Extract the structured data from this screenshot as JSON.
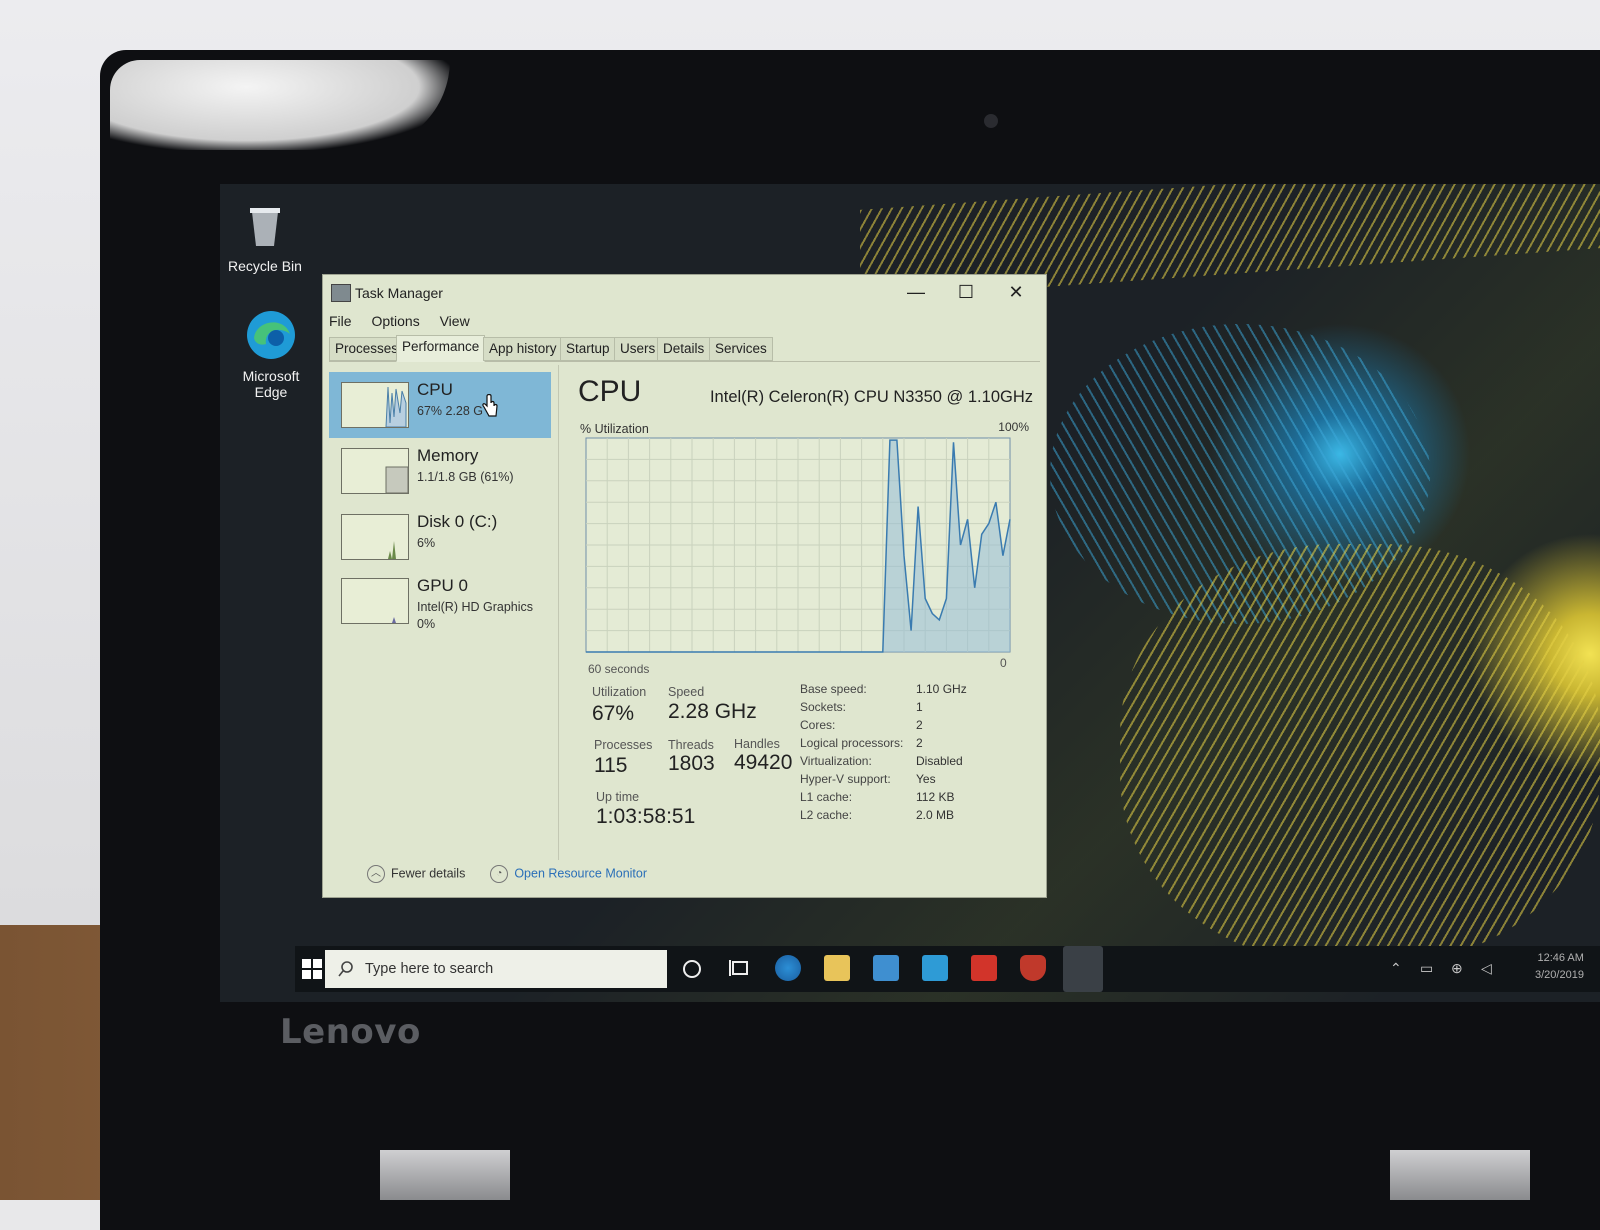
{
  "desktop": {
    "icons": [
      {
        "label": "Recycle Bin",
        "icon": "recycle-bin-icon"
      },
      {
        "label": "Microsoft Edge",
        "icon": "edge-icon"
      }
    ],
    "brand": "Lenovo"
  },
  "window": {
    "title": "Task Manager",
    "controls": {
      "minimize": "—",
      "maximize": "☐",
      "close": "✕"
    }
  },
  "menu": [
    "File",
    "Options",
    "View"
  ],
  "tabs": [
    "Processes",
    "Performance",
    "App history",
    "Startup",
    "Users",
    "Details",
    "Services"
  ],
  "active_tab": "Performance",
  "sidebar": [
    {
      "name": "CPU",
      "sub": "67% 2.28 G",
      "selected": true
    },
    {
      "name": "Memory",
      "sub": "1.1/1.8 GB (61%)",
      "selected": false
    },
    {
      "name": "Disk 0 (C:)",
      "sub": "6%",
      "selected": false
    },
    {
      "name": "GPU 0",
      "sub": "Intel(R) HD Graphics",
      "sub2": "0%",
      "selected": false
    }
  ],
  "detail": {
    "title": "CPU",
    "model": "Intel(R) Celeron(R) CPU N3350 @ 1.10GHz",
    "graph_label": "% Utilization",
    "graph_max": "100%",
    "graph_time": "60 seconds",
    "graph_min": "0",
    "stats": {
      "utilization_label": "Utilization",
      "utilization": "67%",
      "speed_label": "Speed",
      "speed": "2.28 GHz",
      "processes_label": "Processes",
      "processes": "115",
      "threads_label": "Threads",
      "threads": "1803",
      "handles_label": "Handles",
      "handles": "49420",
      "uptime_label": "Up time",
      "uptime": "1:03:58:51"
    },
    "specs": [
      {
        "k": "Base speed:",
        "v": "1.10 GHz"
      },
      {
        "k": "Sockets:",
        "v": "1"
      },
      {
        "k": "Cores:",
        "v": "2"
      },
      {
        "k": "Logical processors:",
        "v": "2"
      },
      {
        "k": "Virtualization:",
        "v": "Disabled"
      },
      {
        "k": "Hyper-V support:",
        "v": "Yes"
      },
      {
        "k": "L1 cache:",
        "v": "112 KB"
      },
      {
        "k": "L2 cache:",
        "v": "2.0 MB"
      }
    ]
  },
  "footer": {
    "fewer": "Fewer details",
    "resource_monitor": "Open Resource Monitor"
  },
  "taskbar": {
    "search_placeholder": "Type here to search",
    "clock_time": "12:46 AM",
    "clock_date": "3/20/2019"
  },
  "chart_data": {
    "type": "area",
    "ylabel": "% Utilization",
    "ylim": [
      0,
      100
    ],
    "xlabel": "60 seconds",
    "x": [
      60,
      58,
      56,
      54,
      52,
      50,
      48,
      46,
      44,
      42,
      40,
      38,
      36,
      34,
      32,
      30,
      28,
      26,
      24,
      22,
      20,
      18,
      17,
      16,
      15,
      14,
      13,
      12,
      11,
      10,
      9,
      8,
      7,
      6,
      5,
      4,
      3,
      2,
      1,
      0
    ],
    "y": [
      0,
      0,
      0,
      0,
      0,
      0,
      0,
      0,
      0,
      0,
      0,
      0,
      0,
      0,
      0,
      0,
      0,
      0,
      0,
      0,
      0,
      0,
      99,
      99,
      45,
      10,
      68,
      25,
      18,
      15,
      25,
      98,
      50,
      62,
      30,
      55,
      60,
      70,
      45,
      62
    ]
  }
}
